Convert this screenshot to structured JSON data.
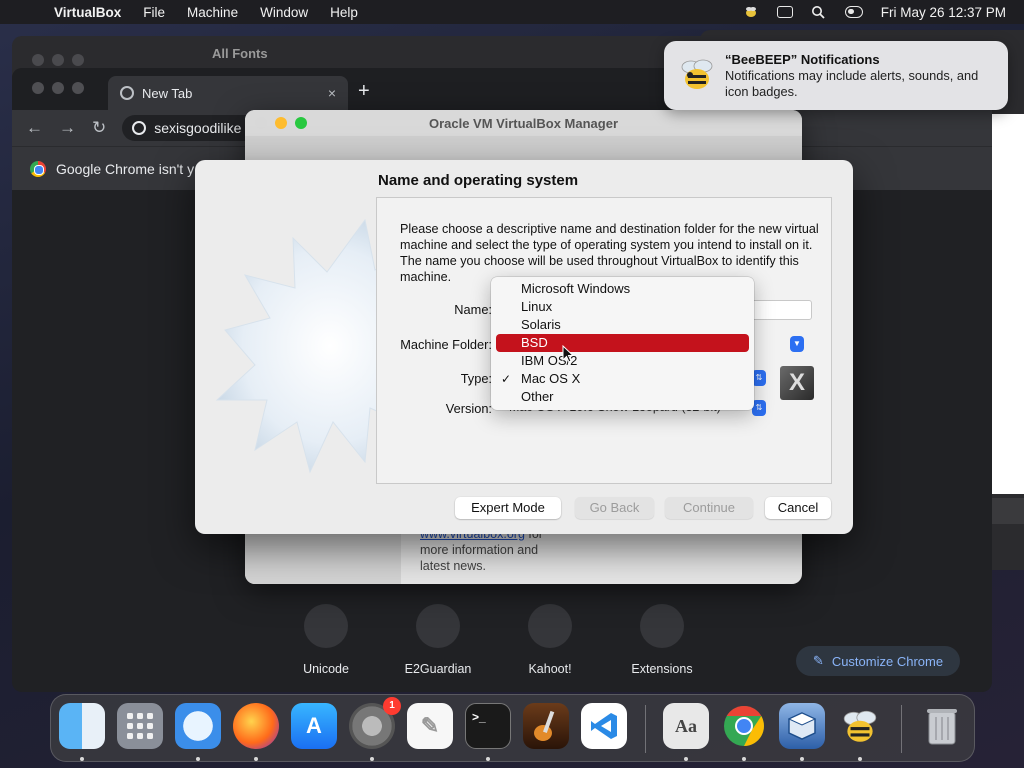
{
  "menubar": {
    "app_name": "VirtualBox",
    "menus": [
      "File",
      "Machine",
      "Window",
      "Help"
    ],
    "datetime": "Fri May 26  12:37 PM"
  },
  "fonts_window": {
    "title": "All Fonts"
  },
  "chrome": {
    "tab_title": "New Tab",
    "tab_close": "×",
    "new_tab": "+",
    "address": "sexisgoodilike",
    "infobar_text": "Google Chrome isn't y",
    "shortcuts": [
      "Unicode",
      "E2Guardian",
      "Kahoot!",
      "Extensions"
    ],
    "customize_label": "Customize Chrome"
  },
  "vbox_manager": {
    "title": "Oracle VM VirtualBox Manager",
    "info_link": "www.virtualbox.org",
    "info_link_suffix": " for",
    "info_text_line2": "more information and",
    "info_text_line3": "latest news."
  },
  "dialog": {
    "heading": "Name and operating system",
    "description": "Please choose a descriptive name and destination folder for the new virtual machine and select the type of operating system you intend to install on it. The name you choose will be used throughout VirtualBox to identify this machine.",
    "labels": {
      "name": "Name:",
      "machine_folder": "Machine Folder:",
      "type": "Type:",
      "version": "Version:"
    },
    "version_value": "Mac OS X 10.6 Snow Leopard (32-bit)",
    "buttons": {
      "expert_mode": "Expert Mode",
      "go_back": "Go Back",
      "continue": "Continue",
      "cancel": "Cancel"
    }
  },
  "type_dropdown": {
    "items": [
      "Microsoft Windows",
      "Linux",
      "Solaris",
      "BSD",
      "IBM OS/2",
      "Mac OS X",
      "Other"
    ],
    "highlighted": "BSD",
    "selected": "Mac OS X",
    "check_glyph": "✓"
  },
  "notification": {
    "title": "“BeeBEEP” Notifications",
    "body": "Notifications may include alerts, sounds, and icon badges."
  },
  "dock": {
    "settings_badge": "1",
    "icons": [
      "finder-icon",
      "launchpad-icon",
      "safari-icon",
      "firefox-icon",
      "app-store-icon",
      "system-settings-icon",
      "textedit-icon",
      "terminal-icon",
      "garageband-icon",
      "vscode-icon",
      "font-book-icon",
      "chrome-icon",
      "virtualbox-icon",
      "beebeep-icon",
      "trash-icon"
    ]
  },
  "colors": {
    "highlight": "#c4121c",
    "link": "#2050c0",
    "accent_blue": "#2c6ff2"
  }
}
